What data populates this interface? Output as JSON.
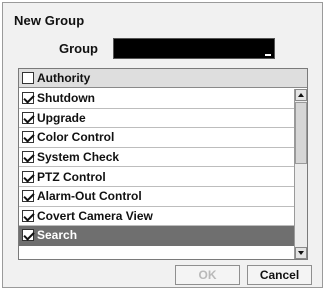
{
  "dialog": {
    "title": "New Group",
    "group_label": "Group",
    "group_value": ""
  },
  "list": {
    "header": {
      "label": "Authority",
      "checked": false
    },
    "items": [
      {
        "label": "Shutdown",
        "checked": true,
        "selected": false
      },
      {
        "label": "Upgrade",
        "checked": true,
        "selected": false
      },
      {
        "label": "Color Control",
        "checked": true,
        "selected": false
      },
      {
        "label": "System Check",
        "checked": true,
        "selected": false
      },
      {
        "label": "PTZ Control",
        "checked": true,
        "selected": false
      },
      {
        "label": "Alarm-Out Control",
        "checked": true,
        "selected": false
      },
      {
        "label": "Covert Camera View",
        "checked": true,
        "selected": false
      },
      {
        "label": "Search",
        "checked": true,
        "selected": true
      }
    ]
  },
  "buttons": {
    "ok_label": "OK",
    "ok_enabled": false,
    "cancel_label": "Cancel"
  },
  "colors": {
    "selected_row": "#6f6f6f",
    "input_bg": "#000000",
    "disabled_text": "#b9b9b9"
  }
}
